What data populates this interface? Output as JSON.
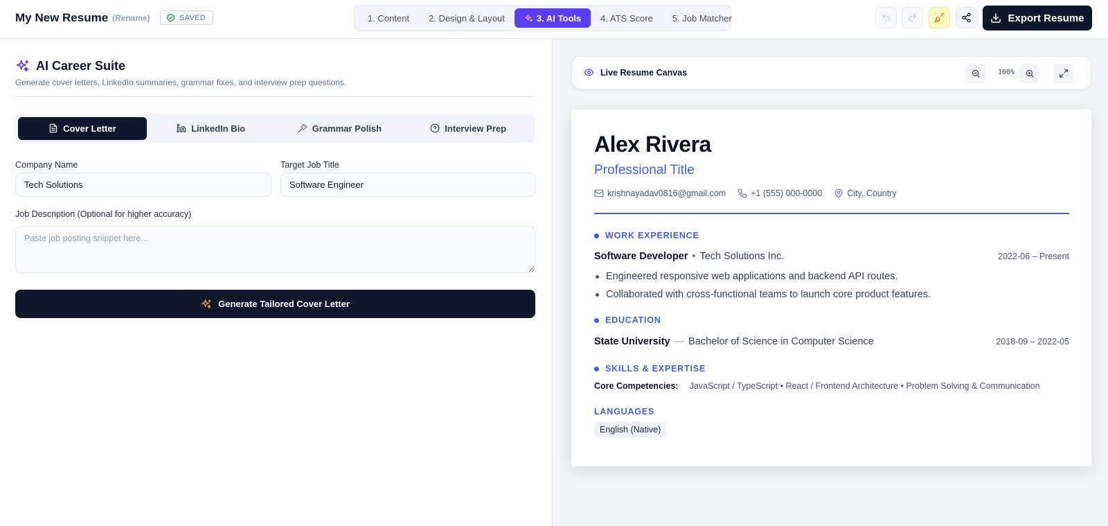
{
  "header": {
    "doc_title": "My New Resume",
    "rename": "(Rename)",
    "saved": "SAVED",
    "steps": [
      "1. Content",
      "2. Design & Layout",
      "3. AI Tools",
      "4. ATS Score",
      "5. Job Matcher"
    ],
    "active_step": 2,
    "export": "Export Resume"
  },
  "ai_suite": {
    "title": "AI Career Suite",
    "subtitle": "Generate cover letters, LinkedIn summaries, grammar fixes, and interview prep questions.",
    "tabs": [
      "Cover Letter",
      "LinkedIn Bio",
      "Grammar Polish",
      "Interview Prep"
    ],
    "active_tab": 0,
    "company_label": "Company Name",
    "company_value": "Tech Solutions",
    "job_title_label": "Target Job Title",
    "job_title_value": "Software Engineer",
    "jd_label": "Job Description (Optional for higher accuracy)",
    "jd_placeholder": "Paste job posting snippet here...",
    "generate": "Generate Tailored Cover Letter"
  },
  "canvas": {
    "title": "Live Resume Canvas",
    "zoom": "100%"
  },
  "resume": {
    "name": "Alex Rivera",
    "title": "Professional Title",
    "email": "krishnayadav0816@gmail.com",
    "phone": "+1 (555) 000-0000",
    "location": "City, Country",
    "work_heading": "WORK EXPERIENCE",
    "job_role": "Software Developer",
    "job_sep": "•",
    "job_company": "Tech Solutions Inc.",
    "job_dates": "2022-06 – Present",
    "bullets": [
      "Engineered responsive web applications and backend API routes.",
      "Collaborated with cross-functional teams to launch core product features."
    ],
    "edu_heading": "EDUCATION",
    "school": "State University",
    "edu_sep": "—",
    "degree": "Bachelor of Science in Computer Science",
    "edu_dates": "2018-09 – 2022-05",
    "skills_heading": "SKILLS & EXPERTISE",
    "skills_label": "Core Competencies:",
    "skills_value": "JavaScript / TypeScript • React / Frontend Architecture • Problem Solving & Communication",
    "languages_heading": "LANGUAGES",
    "language": "English (Native)"
  },
  "colors": {
    "accent": "#5b3df5",
    "resume_blue": "#3f5ee8",
    "navy": "#0f172a",
    "success": "#16a34a",
    "sparkle": "#f59e0b"
  },
  "icons": [
    "check-circle-icon",
    "undo-icon",
    "redo-icon",
    "party-popper-icon",
    "share-icon",
    "download-icon",
    "sparkles-icon",
    "file-text-icon",
    "linkedin-icon",
    "magic-wand-icon",
    "help-circle-icon",
    "eye-icon",
    "zoom-out-icon",
    "zoom-in-icon",
    "maximize-icon",
    "mail-icon",
    "phone-icon",
    "map-pin-icon"
  ]
}
